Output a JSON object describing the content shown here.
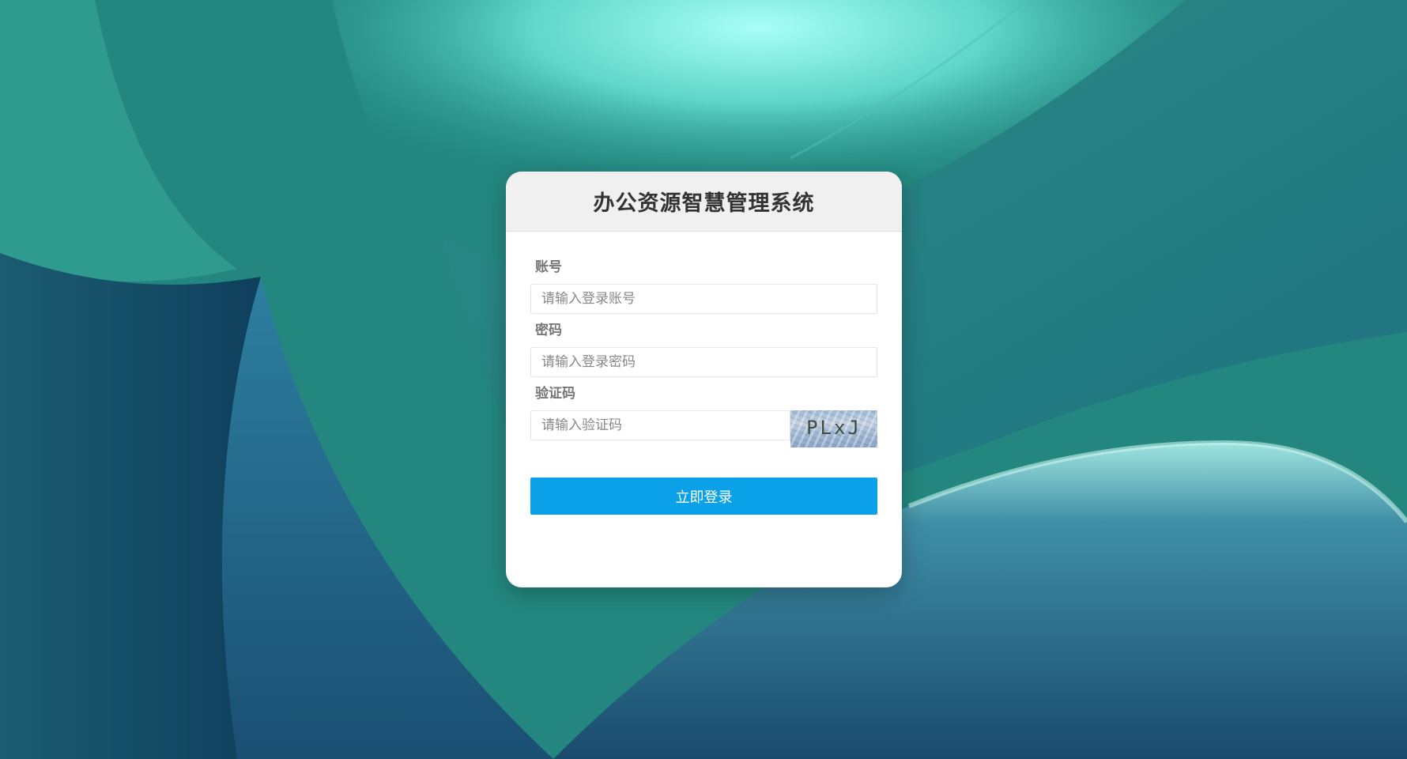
{
  "app": {
    "title": "办公资源智慧管理系统"
  },
  "form": {
    "account": {
      "label": "账号",
      "placeholder": "请输入登录账号",
      "value": ""
    },
    "password": {
      "label": "密码",
      "placeholder": "请输入登录密码",
      "value": ""
    },
    "captcha": {
      "label": "验证码",
      "placeholder": "请输入验证码",
      "value": "",
      "image_text": "PLxJ"
    },
    "submit_label": "立即登录"
  },
  "colors": {
    "primary_button": "#0aa1e8",
    "header_bg": "#f0f0f0",
    "background_teal": "#1f8f87"
  }
}
